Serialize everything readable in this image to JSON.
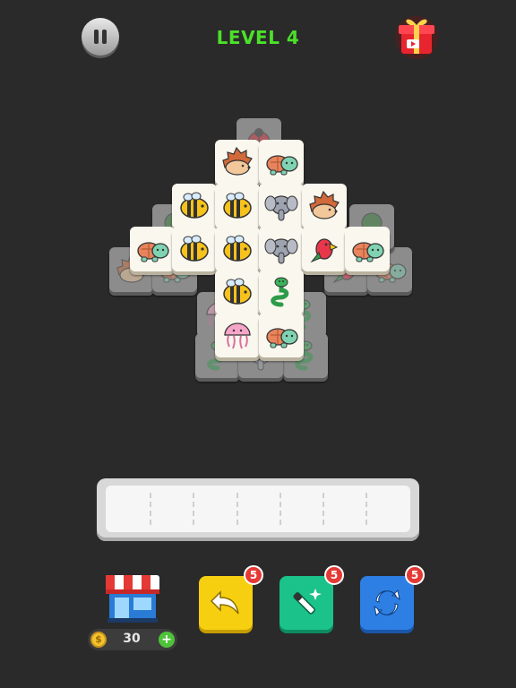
{
  "header": {
    "level_label": "LEVEL 4"
  },
  "icons": {
    "pause": "pause-icon",
    "gift": "gift-icon",
    "shop": "shop-icon",
    "undo": "undo-icon",
    "magic": "magic-wand-icon",
    "shuffle": "shuffle-icon",
    "coin": "coin-icon",
    "add": "plus-icon"
  },
  "wallet": {
    "coins": "30",
    "coin_symbol": "$",
    "add_symbol": "+"
  },
  "boosters": {
    "undo_count": "5",
    "magic_count": "5",
    "shuffle_count": "5"
  },
  "colors": {
    "level_text": "#4be02a",
    "undo": "#f6cf11",
    "magic": "#1bc28a",
    "shuffle": "#2e7fe3",
    "badge": "#e53935",
    "tile_face": "#faf7ee",
    "background": "#2a2a2a"
  },
  "tray": {
    "slots": 7
  },
  "board": {
    "active_tiles": [
      "hedgehog",
      "turtle",
      "bee",
      "bee",
      "elephant",
      "hedgehog",
      "turtle",
      "bee",
      "bee",
      "elephant",
      "parrot",
      "turtle",
      "bee",
      "snake",
      "jellyfish",
      "turtle"
    ],
    "blocked_tiles": [
      "ladybug",
      "hedgehog",
      "turtle",
      "jellyfish",
      "snake",
      "parrot",
      "turtle",
      "snake",
      "snake",
      "elephant",
      "tree",
      "tree"
    ]
  }
}
